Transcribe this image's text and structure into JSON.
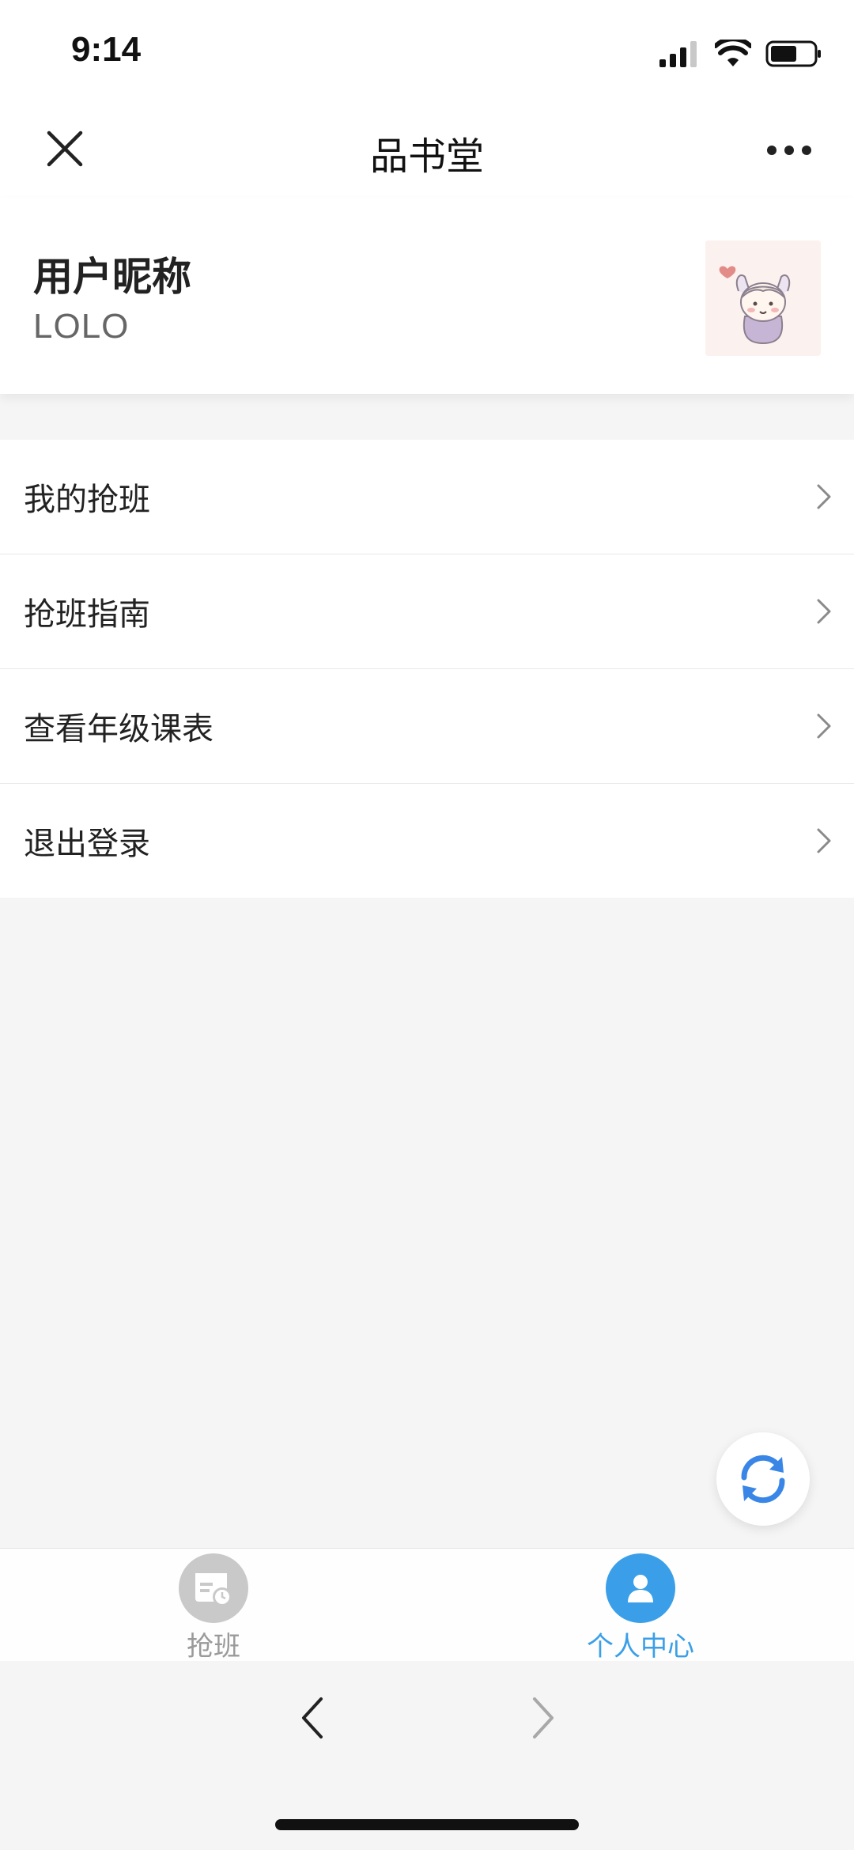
{
  "status_bar": {
    "time": "9:14"
  },
  "nav": {
    "title": "品书堂"
  },
  "profile": {
    "label": "用户昵称",
    "nickname": "LOLO"
  },
  "menu": {
    "items": [
      {
        "label": "我的抢班"
      },
      {
        "label": "抢班指南"
      },
      {
        "label": "查看年级课表"
      },
      {
        "label": "退出登录"
      }
    ]
  },
  "tab_bar": {
    "tabs": [
      {
        "label": "抢班",
        "active": false
      },
      {
        "label": "个人中心",
        "active": true
      }
    ]
  },
  "colors": {
    "accent": "#3a9fe8",
    "inactive": "#9a9a9a",
    "background": "#f5f5f5"
  }
}
